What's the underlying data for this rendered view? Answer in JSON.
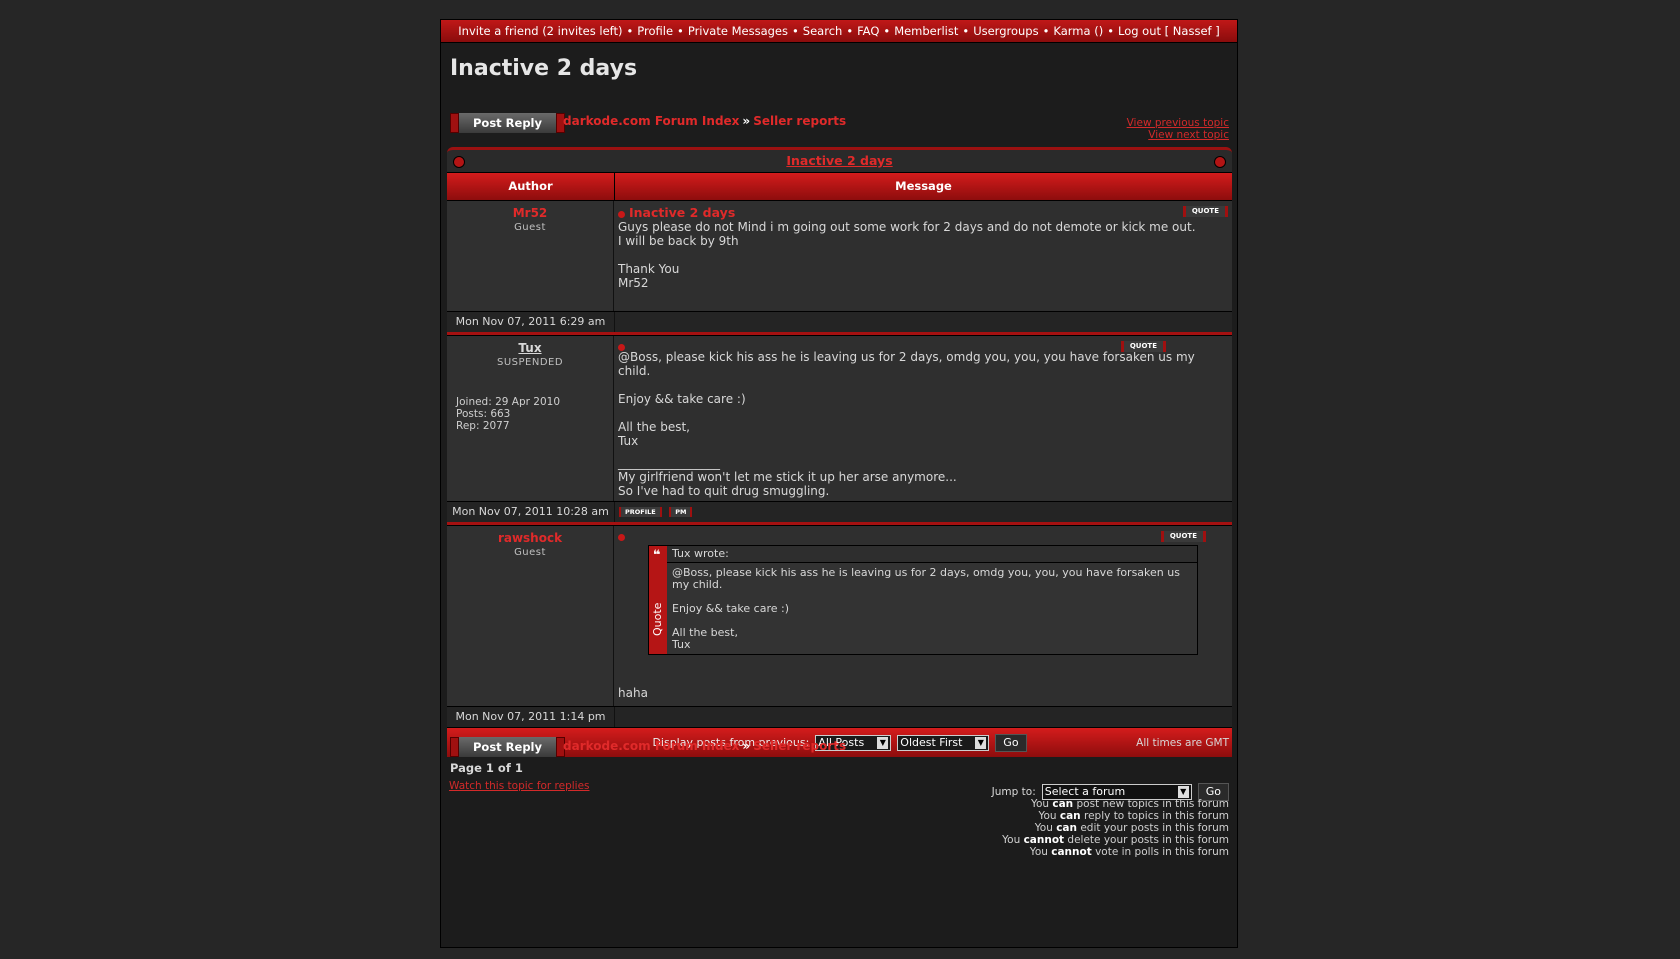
{
  "topnav": {
    "items": [
      "Invite a friend (2 invites left)",
      "Profile",
      "Private Messages",
      "Search",
      "FAQ",
      "Memberlist",
      "Usergroups",
      "Karma ()",
      "Log out [ Nassef ]"
    ],
    "separator": "•"
  },
  "page_title": "Inactive 2 days",
  "post_reply_label": "Post Reply",
  "breadcrumb": {
    "index": "darkode.com Forum Index",
    "arrow": "»",
    "forum": "Seller reports"
  },
  "topic_nav": {
    "prev": "View previous topic",
    "next": "View next topic"
  },
  "table": {
    "topic_title": "Inactive 2 days",
    "col_author": "Author",
    "col_message": "Message"
  },
  "posts": [
    {
      "author": "Mr52",
      "rank": "Guest",
      "subject": "Inactive 2 days",
      "lines": [
        "Guys please do not Mind i m going out some work for 2 days and do not demote or kick me out.",
        "I will be back by 9th",
        "",
        "Thank You",
        "Mr52"
      ],
      "date": "Mon Nov 07, 2011 6:29 am",
      "quote_label": "QUOTE"
    },
    {
      "author": "Tux",
      "rank": "SUSPENDED",
      "joined": "Joined: 29 Apr 2010",
      "posts": "Posts: 663",
      "rep": "Rep: 2077",
      "lines": [
        "@Boss, please kick his ass he is leaving us for 2 days, omdg you, you, you have forsaken us my child.",
        "",
        "Enjoy && take care :)",
        "",
        "All the best,",
        "Tux"
      ],
      "sig_rule": "_________________",
      "sig": [
        "My girlfriend won't let me stick it up her arse anymore...",
        "So I've had to quit drug smuggling."
      ],
      "date": "Mon Nov 07, 2011 10:28 am",
      "quote_label": "QUOTE",
      "profile_label": "PROFILE",
      "pm_label": "PM"
    },
    {
      "author": "rawshock",
      "rank": "Guest",
      "quote_author": "Tux wrote:",
      "quote_side": "Quote",
      "quote_lines": [
        "@Boss, please kick his ass he is leaving us for 2 days, omdg you, you, you have forsaken us my child.",
        "",
        "Enjoy && take care :)",
        "",
        "All the best,",
        "Tux"
      ],
      "reply": "haha",
      "date": "Mon Nov 07, 2011 1:14 pm",
      "quote_label": "QUOTE"
    }
  ],
  "display": {
    "label": "Display posts from previous:",
    "posts_value": "All Posts",
    "order_value": "Oldest First",
    "go": "Go"
  },
  "timezone": "All times are GMT",
  "page_info": "Page 1 of 1",
  "watch": "Watch this topic for replies",
  "jump": {
    "label": "Jump to:",
    "value": "Select a forum",
    "go": "Go"
  },
  "permissions": [
    {
      "pre": "You ",
      "b": "can",
      "post": " post new topics in this forum"
    },
    {
      "pre": "You ",
      "b": "can",
      "post": " reply to topics in this forum"
    },
    {
      "pre": "You ",
      "b": "can",
      "post": " edit your posts in this forum"
    },
    {
      "pre": "You ",
      "b": "cannot",
      "post": " delete your posts in this forum"
    },
    {
      "pre": "You ",
      "b": "cannot",
      "post": " vote in polls in this forum"
    }
  ]
}
